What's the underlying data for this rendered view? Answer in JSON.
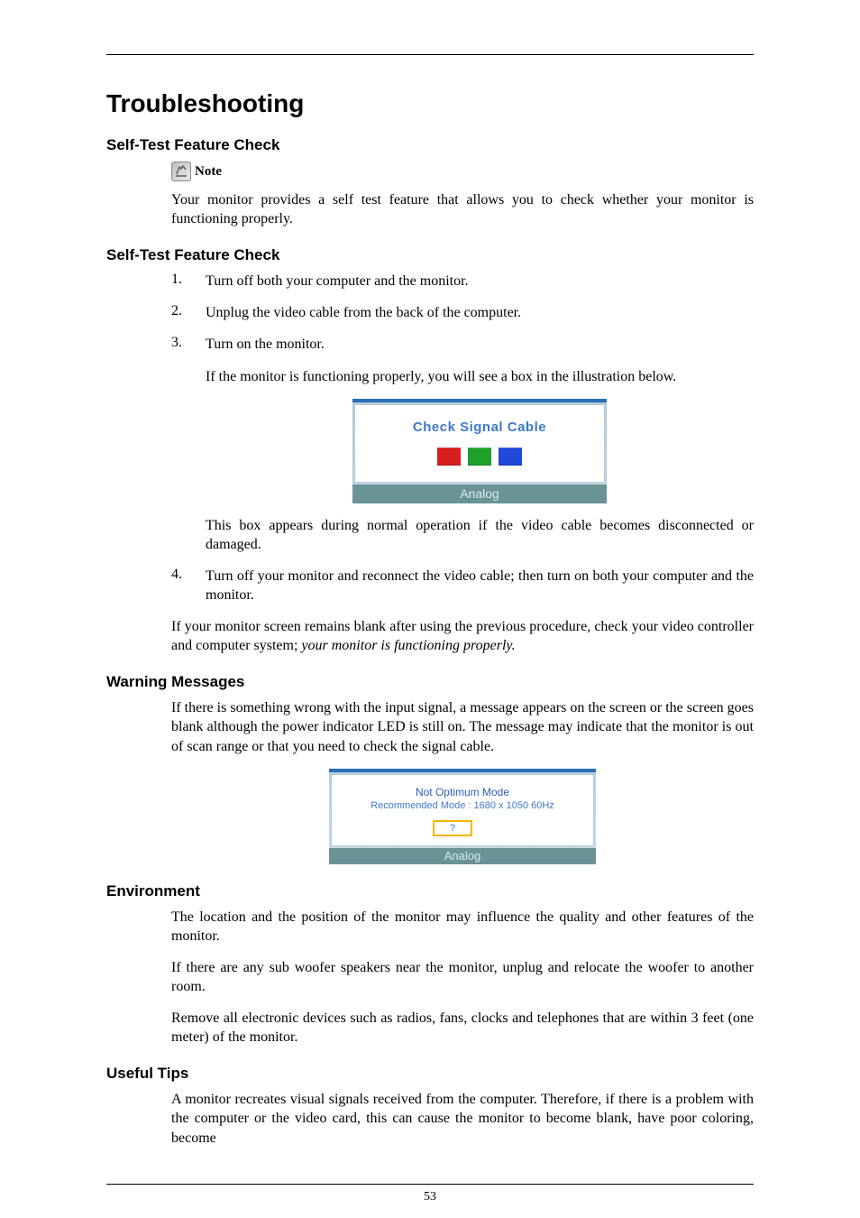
{
  "title": "Troubleshooting",
  "sections": {
    "selfTest1": {
      "heading": "Self-Test Feature Check",
      "noteLabel": "Note",
      "noteBody": "Your monitor provides a self test feature that allows you to check whether your monitor is functioning properly."
    },
    "selfTest2": {
      "heading": "Self-Test Feature Check",
      "steps": {
        "s1": "Turn off both your computer and the monitor.",
        "s2": "Unplug the video cable from the back of the computer.",
        "s3a": "Turn on the monitor.",
        "s3b": "If the monitor is functioning properly, you will see a box in the illustration below.",
        "s3c": "This box appears during normal operation if the video cable becomes disconnected or damaged.",
        "s4": "Turn off your monitor and reconnect the video cable; then turn on both your computer and the monitor."
      },
      "afterList": {
        "p1a": "If your monitor screen remains blank after using the previous procedure, check your video controller and computer system; ",
        "p1b": "your monitor is functioning properly."
      }
    },
    "warning": {
      "heading": "Warning Messages",
      "body": "If there is something wrong with the input signal, a message appears on the screen or the screen goes blank although the power indicator LED is still on. The message may indicate that the monitor is out of scan range or that you need to check the signal cable."
    },
    "environment": {
      "heading": "Environment",
      "p1": "The location and the position of the monitor may influence the quality and other features of the monitor.",
      "p2": "If there are any sub woofer speakers near the monitor, unplug and relocate the woofer to another room.",
      "p3": "Remove all electronic devices such as radios, fans, clocks and telephones that are within 3 feet (one meter) of the monitor."
    },
    "tips": {
      "heading": "Useful Tips",
      "p1": "A monitor recreates visual signals received from the computer. Therefore, if there is a problem with the computer or the video card, this can cause the monitor to become blank, have poor coloring, become"
    }
  },
  "osd1": {
    "message": "Check Signal Cable",
    "colors": {
      "red": "#d81f1f",
      "green": "#1fa02b",
      "blue": "#1f49d8"
    },
    "footer": "Analog"
  },
  "osd2": {
    "title": "Not Optimum Mode",
    "subtitle": "Recommended Mode : 1680 x 1050 60Hz",
    "button": "?",
    "footer": "Analog"
  },
  "pageNumber": "53"
}
